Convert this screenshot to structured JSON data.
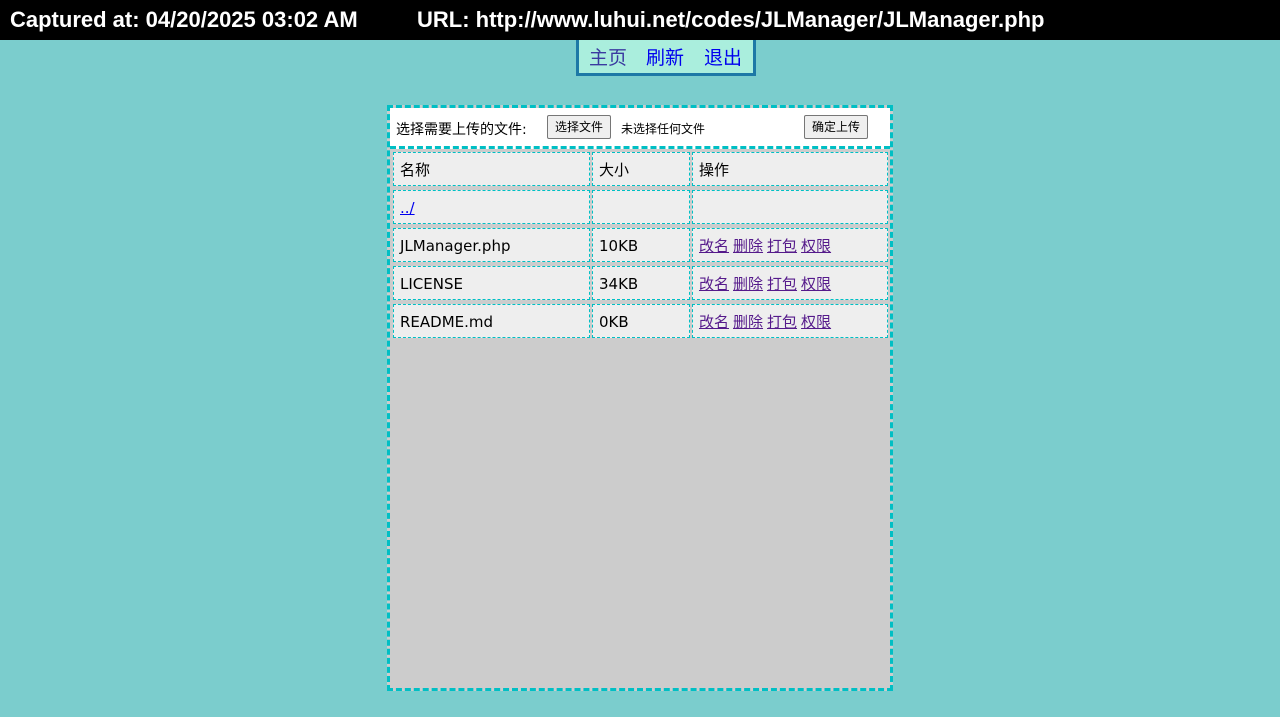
{
  "capture": {
    "time_text": "Captured at: 04/20/2025 03:02 AM",
    "url_text": "URL: http://www.luhui.net/codes/JLManager/JLManager.php"
  },
  "nav": {
    "home": "主页",
    "refresh": "刷新",
    "logout": "退出"
  },
  "upload": {
    "label": "选择需要上传的文件:",
    "choose_button": "选择文件",
    "no_file_text": "未选择任何文件",
    "confirm_button": "确定上传"
  },
  "table": {
    "headers": {
      "name": "名称",
      "size": "大小",
      "actions": "操作"
    },
    "parent_link": "../",
    "rows": [
      {
        "name": "JLManager.php",
        "size": "10KB"
      },
      {
        "name": "LICENSE",
        "size": "34KB"
      },
      {
        "name": "README.md",
        "size": "0KB"
      }
    ],
    "actions": {
      "rename": "改名",
      "delete": "删除",
      "pack": "打包",
      "permission": "权限"
    }
  },
  "colors": {
    "page_background": "#7bcdcd",
    "panel_border": "#00bfc4",
    "nav_background": "#aaeedd"
  }
}
